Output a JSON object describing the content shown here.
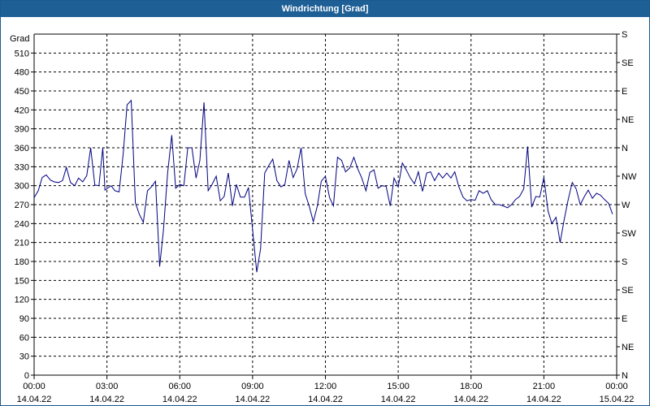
{
  "window": {
    "title": "Windrichtung [Grad]"
  },
  "chart_data": {
    "type": "line",
    "title": "Windrichtung [Grad]",
    "ylabel": "Grad",
    "ylim": [
      0,
      540
    ],
    "y_ticks": [
      0,
      30,
      60,
      90,
      120,
      150,
      180,
      210,
      240,
      270,
      300,
      330,
      360,
      390,
      420,
      450,
      480,
      510
    ],
    "y2_labels": [
      {
        "value": 0,
        "label": "N"
      },
      {
        "value": 45,
        "label": "NE"
      },
      {
        "value": 90,
        "label": "E"
      },
      {
        "value": 135,
        "label": "SE"
      },
      {
        "value": 180,
        "label": "S"
      },
      {
        "value": 225,
        "label": "SW"
      },
      {
        "value": 270,
        "label": "W"
      },
      {
        "value": 315,
        "label": "NW"
      },
      {
        "value": 360,
        "label": "N"
      },
      {
        "value": 405,
        "label": "NE"
      },
      {
        "value": 450,
        "label": "E"
      },
      {
        "value": 495,
        "label": "SE"
      },
      {
        "value": 540,
        "label": "S"
      }
    ],
    "xlim": [
      0,
      24
    ],
    "x_ticks": [
      {
        "value": 0,
        "time": "00:00",
        "date": "14.04.22"
      },
      {
        "value": 3,
        "time": "03:00",
        "date": "14.04.22"
      },
      {
        "value": 6,
        "time": "06:00",
        "date": "14.04.22"
      },
      {
        "value": 9,
        "time": "09:00",
        "date": "14.04.22"
      },
      {
        "value": 12,
        "time": "12:00",
        "date": "14.04.22"
      },
      {
        "value": 15,
        "time": "15:00",
        "date": "14.04.22"
      },
      {
        "value": 18,
        "time": "18:00",
        "date": "14.04.22"
      },
      {
        "value": 21,
        "time": "21:00",
        "date": "14.04.22"
      },
      {
        "value": 24,
        "time": "00:00",
        "date": "15.04.22"
      }
    ],
    "grid": true,
    "series": [
      {
        "color": "#000080",
        "points": [
          [
            0.0,
            281
          ],
          [
            0.17,
            292
          ],
          [
            0.33,
            313
          ],
          [
            0.5,
            317
          ],
          [
            0.67,
            309
          ],
          [
            0.83,
            306
          ],
          [
            1.0,
            305
          ],
          [
            1.17,
            308
          ],
          [
            1.33,
            329
          ],
          [
            1.5,
            305
          ],
          [
            1.67,
            300
          ],
          [
            1.83,
            312
          ],
          [
            2.0,
            306
          ],
          [
            2.17,
            316
          ],
          [
            2.33,
            360
          ],
          [
            2.5,
            301
          ],
          [
            2.67,
            300
          ],
          [
            2.83,
            360
          ],
          [
            2.92,
            293
          ],
          [
            3.17,
            300
          ],
          [
            3.33,
            292
          ],
          [
            3.5,
            290
          ],
          [
            3.67,
            350
          ],
          [
            3.83,
            428
          ],
          [
            4.0,
            435
          ],
          [
            4.17,
            273
          ],
          [
            4.33,
            255
          ],
          [
            4.5,
            242
          ],
          [
            4.67,
            292
          ],
          [
            4.83,
            298
          ],
          [
            5.0,
            307
          ],
          [
            5.17,
            172
          ],
          [
            5.33,
            230
          ],
          [
            5.5,
            320
          ],
          [
            5.67,
            380
          ],
          [
            5.83,
            296
          ],
          [
            6.0,
            302
          ],
          [
            6.17,
            300
          ],
          [
            6.33,
            360
          ],
          [
            6.5,
            360
          ],
          [
            6.67,
            312
          ],
          [
            6.83,
            340
          ],
          [
            7.0,
            432
          ],
          [
            7.17,
            292
          ],
          [
            7.33,
            302
          ],
          [
            7.5,
            315
          ],
          [
            7.67,
            276
          ],
          [
            7.83,
            283
          ],
          [
            8.0,
            320
          ],
          [
            8.17,
            268
          ],
          [
            8.33,
            302
          ],
          [
            8.5,
            282
          ],
          [
            8.67,
            282
          ],
          [
            8.83,
            297
          ],
          [
            9.0,
            230
          ],
          [
            9.17,
            163
          ],
          [
            9.33,
            200
          ],
          [
            9.5,
            320
          ],
          [
            9.67,
            332
          ],
          [
            9.83,
            342
          ],
          [
            10.0,
            308
          ],
          [
            10.17,
            298
          ],
          [
            10.33,
            302
          ],
          [
            10.5,
            340
          ],
          [
            10.67,
            313
          ],
          [
            10.83,
            326
          ],
          [
            11.0,
            360
          ],
          [
            11.17,
            287
          ],
          [
            11.33,
            268
          ],
          [
            11.5,
            243
          ],
          [
            11.67,
            268
          ],
          [
            11.83,
            307
          ],
          [
            12.0,
            315
          ],
          [
            12.17,
            281
          ],
          [
            12.33,
            268
          ],
          [
            12.5,
            345
          ],
          [
            12.67,
            340
          ],
          [
            12.83,
            322
          ],
          [
            13.0,
            328
          ],
          [
            13.17,
            345
          ],
          [
            13.33,
            327
          ],
          [
            13.5,
            312
          ],
          [
            13.67,
            292
          ],
          [
            13.83,
            321
          ],
          [
            14.0,
            325
          ],
          [
            14.17,
            296
          ],
          [
            14.33,
            300
          ],
          [
            14.5,
            299
          ],
          [
            14.67,
            268
          ],
          [
            14.83,
            312
          ],
          [
            15.0,
            298
          ],
          [
            15.17,
            336
          ],
          [
            15.33,
            325
          ],
          [
            15.5,
            312
          ],
          [
            15.67,
            303
          ],
          [
            15.83,
            322
          ],
          [
            16.0,
            291
          ],
          [
            16.17,
            320
          ],
          [
            16.33,
            322
          ],
          [
            16.5,
            308
          ],
          [
            16.67,
            320
          ],
          [
            16.83,
            312
          ],
          [
            17.0,
            320
          ],
          [
            17.17,
            312
          ],
          [
            17.33,
            322
          ],
          [
            17.5,
            298
          ],
          [
            17.67,
            282
          ],
          [
            17.83,
            276
          ],
          [
            18.0,
            278
          ],
          [
            18.17,
            277
          ],
          [
            18.33,
            292
          ],
          [
            18.5,
            288
          ],
          [
            18.67,
            292
          ],
          [
            18.83,
            278
          ],
          [
            19.0,
            270
          ],
          [
            19.17,
            270
          ],
          [
            19.33,
            268
          ],
          [
            19.5,
            265
          ],
          [
            19.67,
            270
          ],
          [
            19.83,
            278
          ],
          [
            20.0,
            283
          ],
          [
            20.17,
            295
          ],
          [
            20.33,
            362
          ],
          [
            20.5,
            266
          ],
          [
            20.67,
            283
          ],
          [
            20.83,
            282
          ],
          [
            21.0,
            313
          ],
          [
            21.17,
            260
          ],
          [
            21.33,
            240
          ],
          [
            21.5,
            250
          ],
          [
            21.67,
            210
          ],
          [
            21.83,
            245
          ],
          [
            22.0,
            278
          ],
          [
            22.17,
            305
          ],
          [
            22.33,
            295
          ],
          [
            22.5,
            270
          ],
          [
            22.67,
            283
          ],
          [
            22.83,
            293
          ],
          [
            23.0,
            280
          ],
          [
            23.17,
            288
          ],
          [
            23.33,
            285
          ],
          [
            23.5,
            278
          ],
          [
            23.67,
            272
          ],
          [
            23.83,
            255
          ]
        ]
      }
    ]
  }
}
